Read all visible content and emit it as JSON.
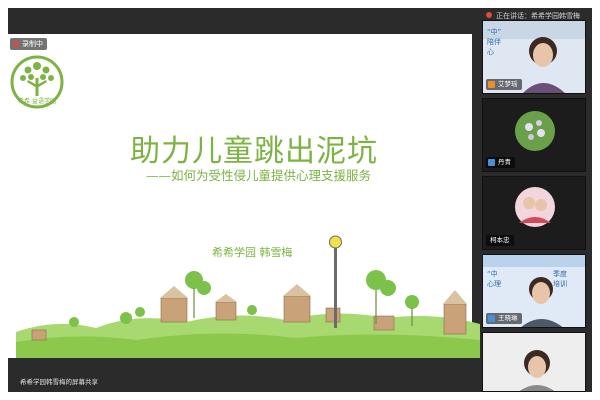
{
  "window": {
    "title": "正在讲话：希希学园韩雪梅"
  },
  "recording": {
    "label": "录制中"
  },
  "slide": {
    "logo_text": "希希 益语学园",
    "title": "助力儿童跳出泥坑",
    "subtitle": "——如何为受性侵儿童提供心理支援服务",
    "author": "希希学园 韩雪梅"
  },
  "share": {
    "label": "希希学园韩雪梅的屏幕共享"
  },
  "participants": [
    {
      "name": "艾梦瑶",
      "overlay_lines": [
        "“中”",
        "陪伴",
        "心"
      ]
    },
    {
      "name": "丹青"
    },
    {
      "name": "柯本忠"
    },
    {
      "name": "王晓琳",
      "overlay_lines": [
        "“中",
        "心理",
        "季度",
        "培训"
      ]
    },
    {
      "name": ""
    }
  ],
  "colors": {
    "accent_green": "#7cb342",
    "rec_red": "#e04a3a",
    "frame": "#2b2b2b"
  }
}
